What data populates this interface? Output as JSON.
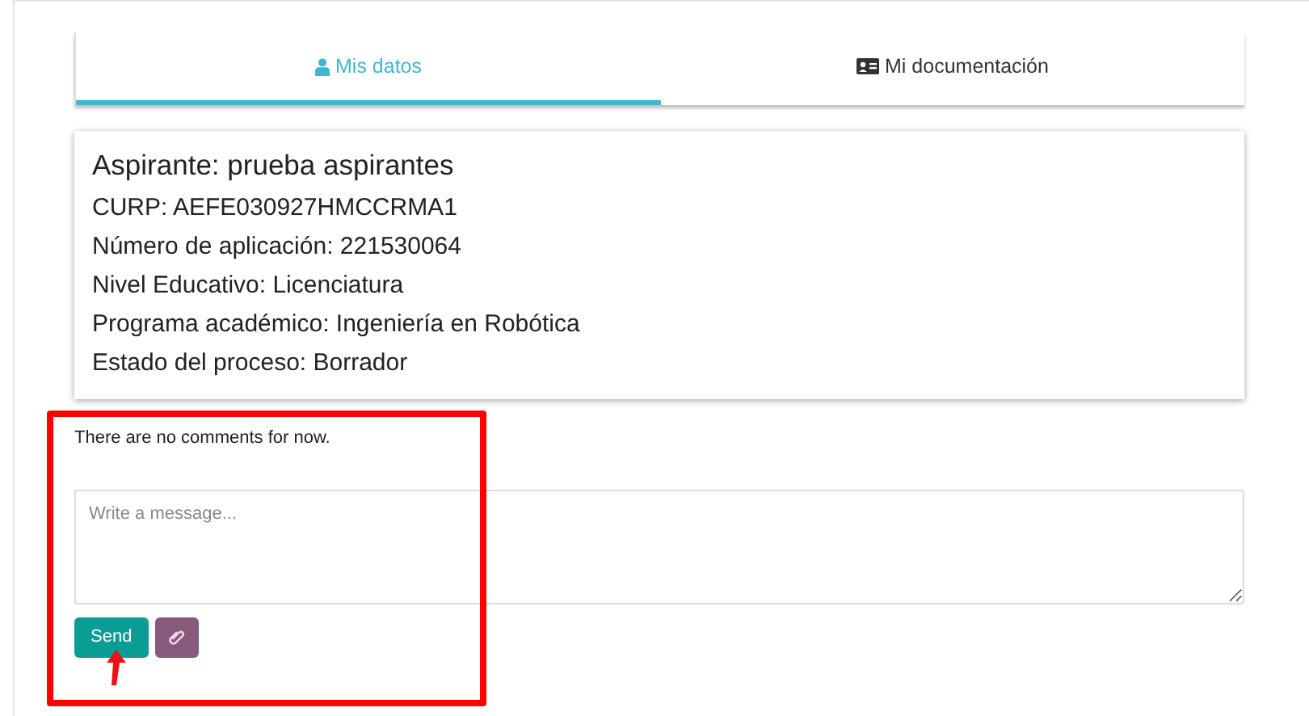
{
  "tabs": [
    {
      "label": "Mis datos",
      "kind": "profile",
      "selected": true
    },
    {
      "label": "Mi documentación",
      "kind": "documents",
      "selected": false
    }
  ],
  "applicant": {
    "title": "Aspirante: prueba aspirantes",
    "lines": [
      "CURP: AEFE030927HMCCRMA1",
      "Número de aplicación: 221530064",
      "Nivel Educativo: Licenciatura",
      "Programa académico: Ingeniería en Robótica",
      "Estado del proceso: Borrador"
    ]
  },
  "comments": {
    "empty_text": "There are no comments for now.",
    "message": {
      "placeholder": "Write a message..."
    },
    "send_button": "Send"
  }
}
